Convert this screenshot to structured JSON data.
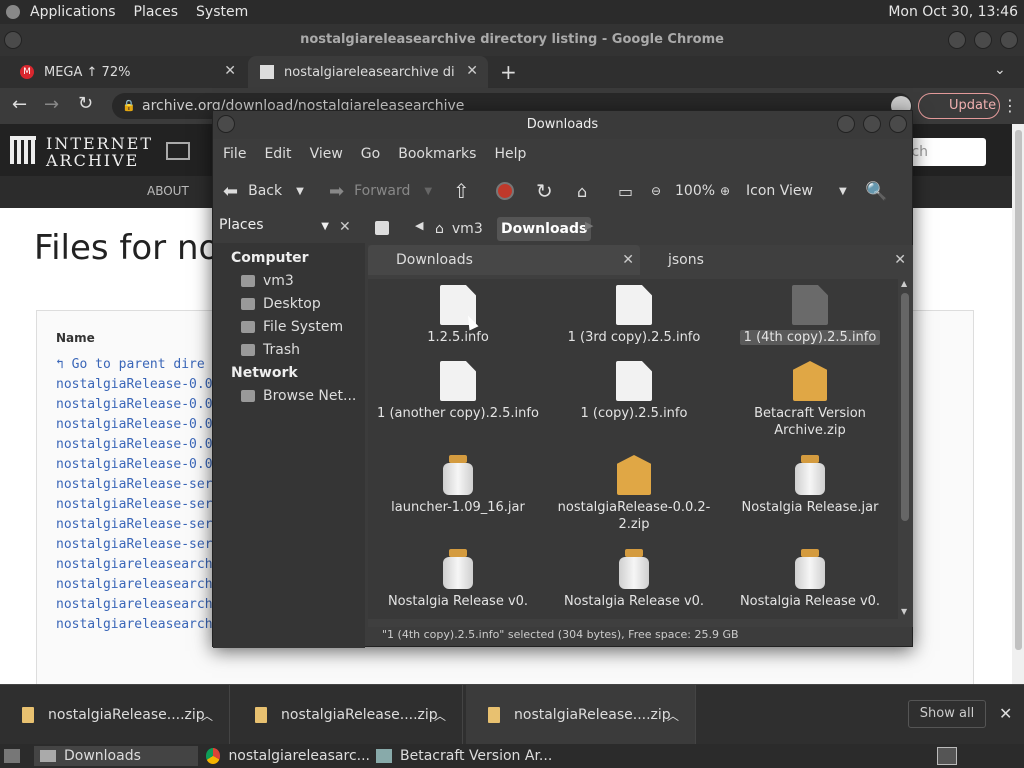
{
  "top_panel": {
    "menus": [
      "Applications",
      "Places",
      "System"
    ],
    "clock": "Mon Oct 30, 13:46"
  },
  "chrome": {
    "window_title": "nostalgiareleasearchive directory listing - Google Chrome",
    "tabs": [
      {
        "label": "MEGA ↑ 72%",
        "icon": "mega-icon"
      },
      {
        "label": "nostalgiareleasearchive direct",
        "icon": "archive-icon"
      }
    ],
    "url": "archive.org/download/nostalgiareleasearchive",
    "update_label": "Update"
  },
  "page": {
    "logo_line1": "INTERNET",
    "logo_line2": "ARCHIVE",
    "search_placeholder": "rch",
    "nav_about": "ABOUT",
    "title": "Files for no",
    "table_header": "Name",
    "rows": [
      "Go to parent dire",
      "nostalgiaRelease-0.0",
      "nostalgiaRelease-0.0",
      "nostalgiaRelease-0.0",
      "nostalgiaRelease-0.0",
      "nostalgiaRelease-0.0",
      "nostalgiaRelease-ser",
      "nostalgiaRelease-ser",
      "nostalgiaRelease-ser",
      "nostalgiaRelease-ser",
      "nostalgiareleasearch",
      "nostalgiareleasearch",
      "nostalgiareleasearch",
      "nostalgiareleasearch"
    ]
  },
  "downloads_shelf": {
    "items": [
      "nostalgiaRelease....zip",
      "nostalgiaRelease....zip",
      "nostalgiaRelease....zip"
    ],
    "show_all": "Show all"
  },
  "taskbar": {
    "items": [
      "Downloads",
      "nostalgiareleasarc...",
      "Betacraft Version Ar..."
    ]
  },
  "nautilus": {
    "title": "Downloads",
    "menus": [
      "File",
      "Edit",
      "View",
      "Go",
      "Bookmarks",
      "Help"
    ],
    "toolbar": {
      "back": "Back",
      "forward": "Forward",
      "zoom": "100%",
      "view_mode": "Icon View"
    },
    "sidebar_mode": "Places",
    "path": [
      "vm3",
      "Downloads"
    ],
    "sidebar": {
      "computer_header": "Computer",
      "computer_items": [
        "vm3",
        "Desktop",
        "File System",
        "Trash"
      ],
      "network_header": "Network",
      "network_items": [
        "Browse Net..."
      ]
    },
    "tabs": [
      "Downloads",
      "jsons"
    ],
    "files": [
      {
        "name": "1.2.5.info",
        "type": "doc"
      },
      {
        "name": "1 (3rd copy).2.5.info",
        "type": "doc"
      },
      {
        "name": "1 (4th copy).2.5.info",
        "type": "doc-selected"
      },
      {
        "name": "1 (another copy).2.5.info",
        "type": "doc"
      },
      {
        "name": "1 (copy).2.5.info",
        "type": "doc"
      },
      {
        "name": "Betacraft Version Archive.zip",
        "type": "zip"
      },
      {
        "name": "launcher-1.09_16.jar",
        "type": "jar"
      },
      {
        "name": "nostalgiaRelease-0.0.2-2.zip",
        "type": "zip"
      },
      {
        "name": "Nostalgia Release.jar",
        "type": "jar"
      },
      {
        "name": "Nostalgia Release v0.",
        "type": "jar"
      },
      {
        "name": "Nostalgia Release v0.",
        "type": "jar"
      },
      {
        "name": "Nostalgia Release v0.",
        "type": "jar"
      }
    ],
    "status": "\"1 (4th copy).2.5.info\" selected (304 bytes), Free space: 25.9 GB"
  }
}
